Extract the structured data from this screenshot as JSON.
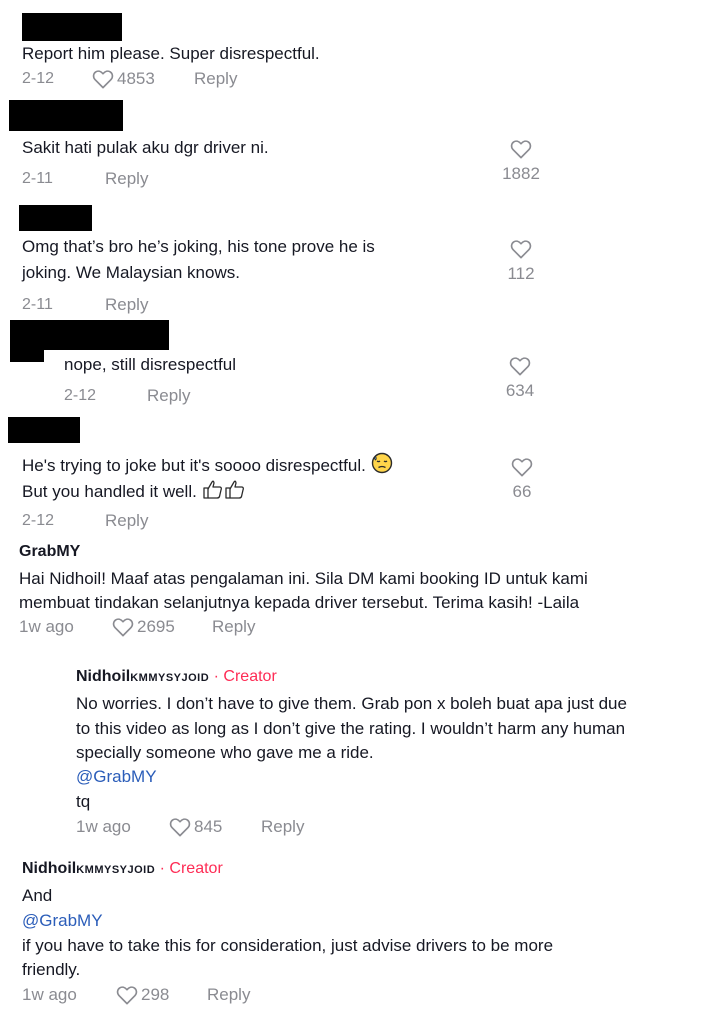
{
  "comments": [
    {
      "text_lines": [
        "Report him please. Super disrespectful."
      ],
      "date": "2-12",
      "likes": "4853",
      "reply_label": "Reply"
    },
    {
      "text_lines": [
        "Sakit hati pulak aku dgr driver ni."
      ],
      "date": "2-11",
      "likes": "1882",
      "reply_label": "Reply"
    },
    {
      "text_lines": [
        "Omg that’s bro he’s joking, his tone prove he is",
        "joking. We Malaysian knows."
      ],
      "date": "2-11",
      "likes": "112",
      "reply_label": "Reply"
    },
    {
      "text_lines": [
        "nope, still disrespectful"
      ],
      "date": "2-12",
      "likes": "634",
      "reply_label": "Reply"
    },
    {
      "text_lines": [
        "He's trying to joke but it's soooo disrespectful.",
        "But you handled it well."
      ],
      "date": "2-12",
      "likes": "66",
      "reply_label": "Reply"
    },
    {
      "author": "GrabMY",
      "text_lines": [
        "Hai Nidhoil! Maaf atas pengalaman ini. Sila DM kami booking ID untuk kami",
        "membuat tindakan selanjutnya kepada driver tersebut. Terima kasih! -Laila"
      ],
      "date": "1w ago",
      "likes": "2695",
      "reply_label": "Reply"
    },
    {
      "author": "Nidhoil",
      "author_suffix": "KMMYSYJOID",
      "badge": "· Creator",
      "text_lines": [
        "No worries. I don’t have to give them. Grab pon x boleh buat apa just due",
        "to this video as long as I don’t give the rating. I wouldn’t harm any human",
        "specially someone who gave me a ride."
      ],
      "mention": "@GrabMY",
      "extra_line": "tq",
      "date": "1w ago",
      "likes": "845",
      "reply_label": "Reply"
    },
    {
      "author": "Nidhoil",
      "author_suffix": "KMMYSYJOID",
      "badge": "· Creator",
      "text_first": "And",
      "mention": "@GrabMY",
      "text_lines": [
        "if you have to take this for consideration, just advise drivers to be more",
        "friendly."
      ],
      "date": "1w ago",
      "likes": "298",
      "reply_label": "Reply"
    }
  ],
  "icons": {
    "like": "heart-outline-icon",
    "emoji_1": "downcast-face-with-sweat-emoji",
    "emoji_2": "thumbs-up-outline-emoji"
  },
  "colors": {
    "creator_badge": "#fe2c55",
    "mention": "#2b5db9",
    "meta": "#8a8b91"
  }
}
